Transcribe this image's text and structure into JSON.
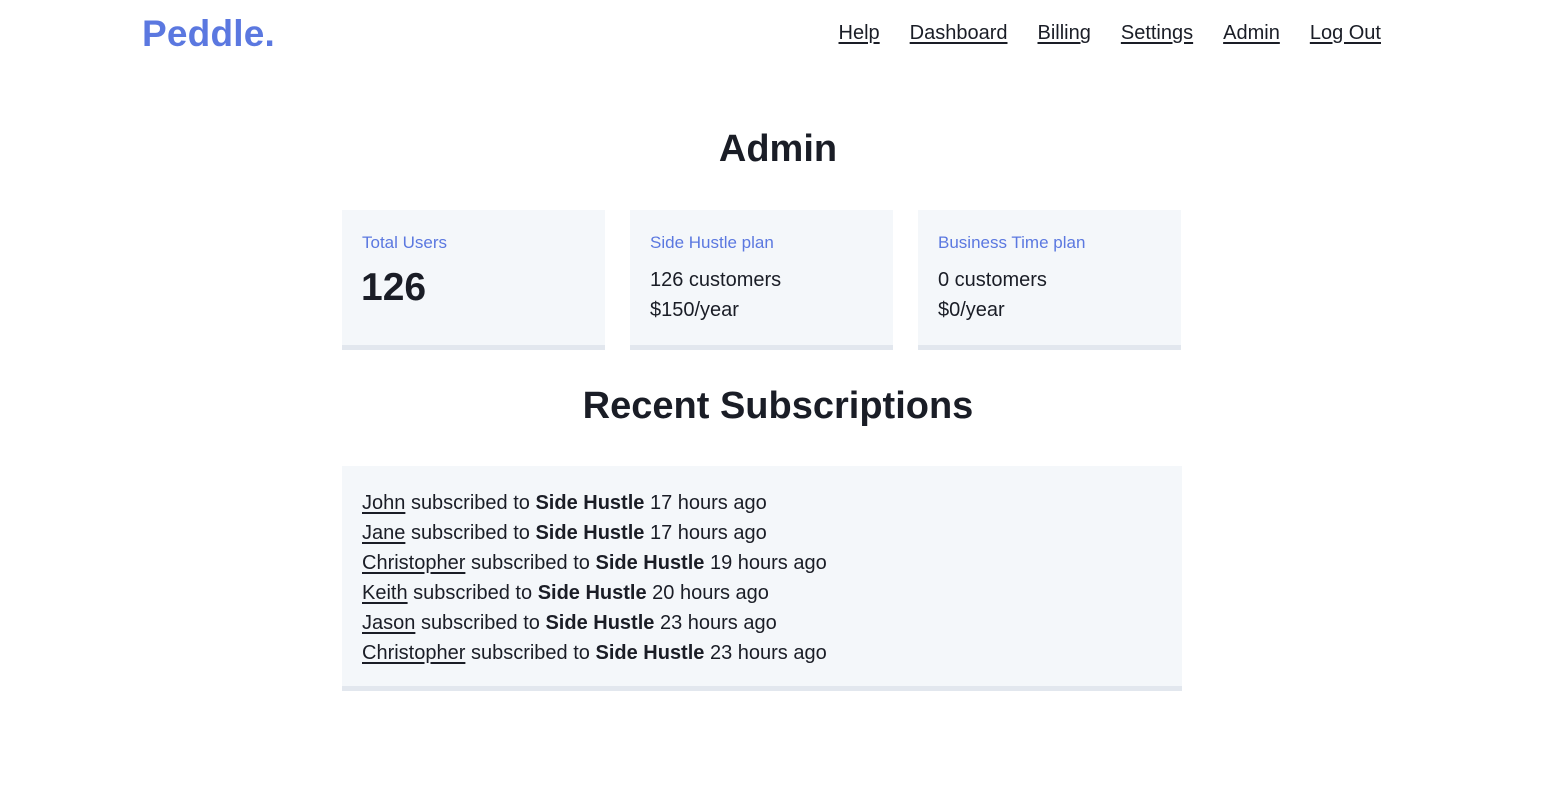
{
  "header": {
    "logo": "Peddle.",
    "nav": [
      "Help",
      "Dashboard",
      "Billing",
      "Settings",
      "Admin",
      "Log Out"
    ]
  },
  "page": {
    "title": "Admin"
  },
  "stats": {
    "total_users": {
      "label": "Total Users",
      "value": "126"
    },
    "side_hustle": {
      "label": "Side Hustle plan",
      "customers": "126 customers",
      "revenue": "$150/year"
    },
    "business_time": {
      "label": "Business Time plan",
      "customers": "0 customers",
      "revenue": "$0/year"
    }
  },
  "recent": {
    "title": "Recent Subscriptions",
    "connector": "subscribed to",
    "items": [
      {
        "name": "John",
        "plan": "Side Hustle",
        "time": "17 hours ago"
      },
      {
        "name": "Jane",
        "plan": "Side Hustle",
        "time": "17 hours ago"
      },
      {
        "name": "Christopher",
        "plan": "Side Hustle",
        "time": "19 hours ago"
      },
      {
        "name": "Keith",
        "plan": "Side Hustle",
        "time": "20 hours ago"
      },
      {
        "name": "Jason",
        "plan": "Side Hustle",
        "time": "23 hours ago"
      },
      {
        "name": "Christopher",
        "plan": "Side Hustle",
        "time": "23 hours ago"
      }
    ]
  },
  "colors": {
    "brand": "#5b78e0",
    "text": "#1a1d26",
    "panel": "#f4f7fa",
    "panel_border": "#e2e7ee"
  }
}
